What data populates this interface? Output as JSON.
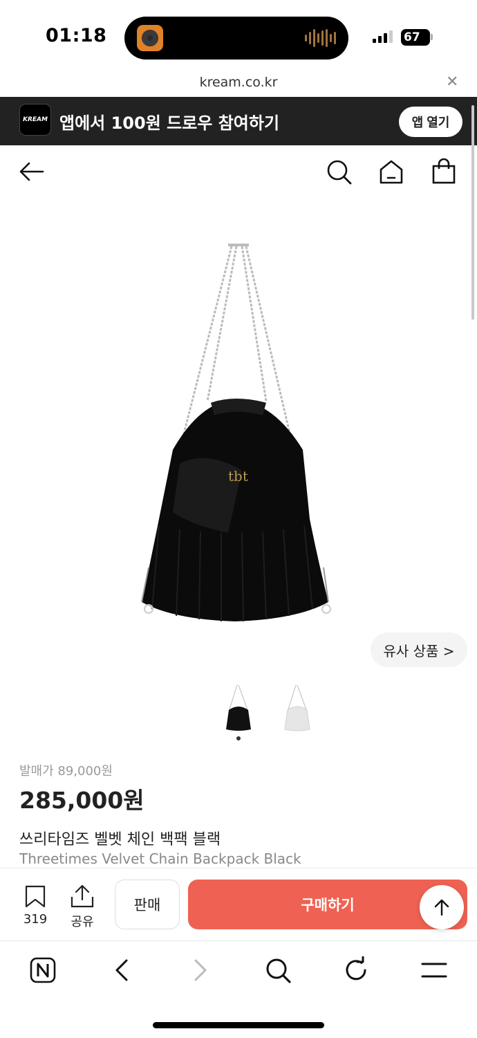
{
  "status_bar": {
    "time": "01:18",
    "battery": "67"
  },
  "browser": {
    "url": "kream.co.kr"
  },
  "app_banner": {
    "logo_text": "KREAM",
    "message": "앱에서 100원 드로우 참여하기",
    "open_button": "앱 열기"
  },
  "similar_products_label": "유사 상품 >",
  "product": {
    "release_price": "발매가 89,000원",
    "price": "285,000원",
    "name_ko": "쓰리타임즈 벨벳 체인 백팩 블랙",
    "name_en": "Threetimes Velvet Chain Backpack Black",
    "colors": [
      "black",
      "white"
    ],
    "selected_thumbnail": 0
  },
  "action_bar": {
    "bookmark_count": "319",
    "share_label": "공유",
    "sell_label": "판매",
    "buy_label": "구매하기"
  },
  "colors": {
    "buy_button": "#ef6253",
    "banner_bg": "#222222"
  }
}
